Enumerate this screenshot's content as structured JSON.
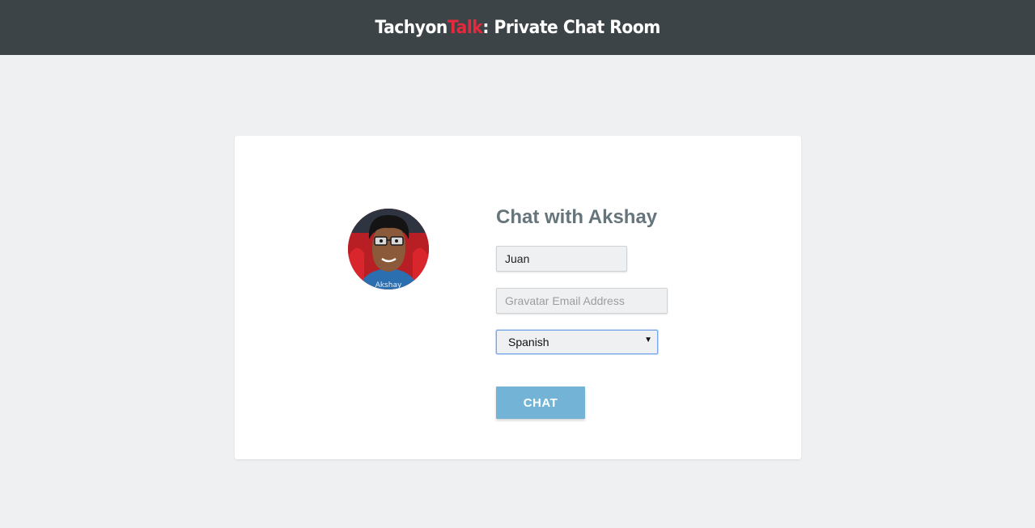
{
  "header": {
    "brand_prefix": "Tachyon",
    "brand_accent": "Talk",
    "brand_suffix": ": Private Chat Room",
    "accent_color": "#e8283d"
  },
  "card": {
    "avatar": {
      "icon": "user-avatar-icon",
      "caption": "Akshay"
    },
    "heading": "Chat with Akshay",
    "name_field": {
      "value": "Juan",
      "placeholder": ""
    },
    "email_field": {
      "value": "",
      "placeholder": "Gravatar Email Address"
    },
    "language_select": {
      "selected": "Spanish"
    },
    "chat_button_label": "CHAT"
  },
  "colors": {
    "header_bg": "#3d4447",
    "page_bg": "#eff0f1",
    "button_bg": "#72b3d6",
    "heading_text": "#66747c"
  }
}
